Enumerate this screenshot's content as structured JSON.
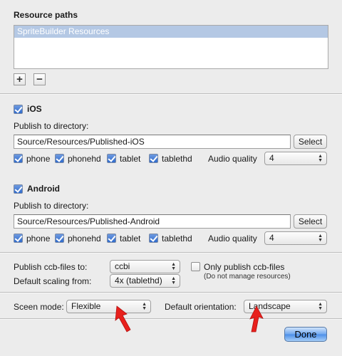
{
  "resource_paths": {
    "title": "Resource paths",
    "items": [
      "SpriteBuilder Resources"
    ],
    "add_label": "+",
    "remove_label": "−"
  },
  "ios": {
    "title": "iOS",
    "publish_label": "Publish to directory:",
    "directory": "Source/Resources/Published-iOS",
    "select_label": "Select",
    "options": [
      "phone",
      "phonehd",
      "tablet",
      "tablethd"
    ],
    "audio_label": "Audio quality",
    "audio_value": "4"
  },
  "android": {
    "title": "Android",
    "publish_label": "Publish to directory:",
    "directory": "Source/Resources/Published-Android",
    "select_label": "Select",
    "options": [
      "phone",
      "phonehd",
      "tablet",
      "tablethd"
    ],
    "audio_label": "Audio quality",
    "audio_value": "4"
  },
  "publish": {
    "ccb_label": "Publish ccb-files to:",
    "ccb_value": "ccbi",
    "only_publish_label": "Only publish ccb-files",
    "only_publish_note": "(Do not manage resources)",
    "scaling_label": "Default scaling from:",
    "scaling_value": "4x (tablethd)"
  },
  "screen": {
    "mode_label": "Sceen mode:",
    "mode_value": "Flexible",
    "orientation_label": "Default orientation:",
    "orientation_value": "Landscape"
  },
  "done_label": "Done",
  "colors": {
    "annotation_arrow": "#e8201c",
    "selection": "#b4c8e4"
  }
}
